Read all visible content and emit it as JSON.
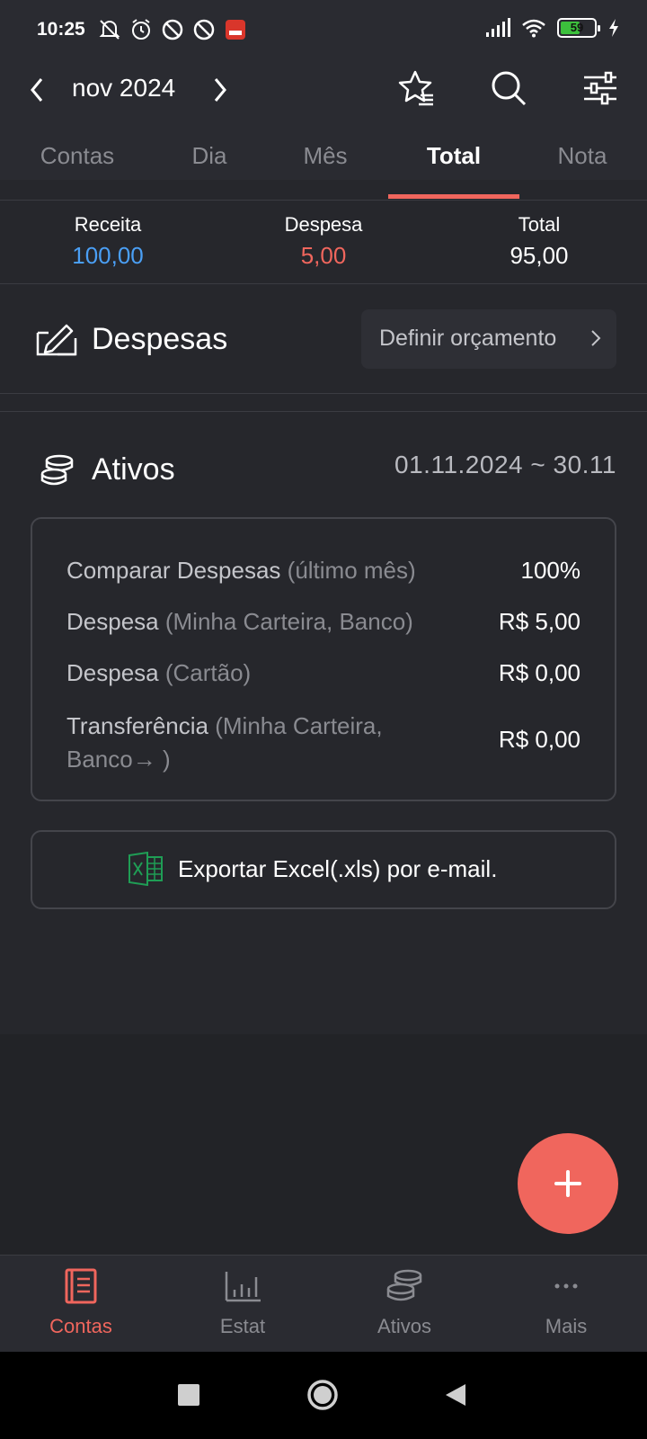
{
  "status_bar": {
    "time": "10:25",
    "battery": "59",
    "battery_level": 0.59,
    "icons_left": [
      "mute-bell-icon",
      "alarm-icon",
      "blocked-icon",
      "blocked-icon",
      "app-notification-icon"
    ],
    "icons_right": [
      "signal-icon",
      "wifi-icon",
      "battery-icon",
      "charging-icon"
    ]
  },
  "header": {
    "month": "nov 2024",
    "icons": [
      "chevron-left-icon",
      "chevron-right-icon",
      "star-list-icon",
      "search-icon",
      "filter-sliders-icon"
    ]
  },
  "tabs": [
    {
      "label": "Contas",
      "active": false
    },
    {
      "label": "Dia",
      "active": false
    },
    {
      "label": "Mês",
      "active": false
    },
    {
      "label": "Total",
      "active": true
    },
    {
      "label": "Nota",
      "active": false
    }
  ],
  "summary": {
    "income_label": "Receita",
    "income_value": "100,00",
    "expense_label": "Despesa",
    "expense_value": "5,00",
    "total_label": "Total",
    "total_value": "95,00"
  },
  "despesas": {
    "title": "Despesas",
    "budget_button": "Definir orçamento"
  },
  "ativos": {
    "title": "Ativos",
    "date_range": "01.11.2024  ~  30.11",
    "rows": [
      {
        "label": "Comparar Despesas",
        "sub": " (último mês)",
        "value": "100%"
      },
      {
        "label": "Despesa",
        "sub": " (Minha Carteira, Banco)",
        "value": "R$ 5,00"
      },
      {
        "label": "Despesa",
        "sub": " (Cartão)",
        "value": "R$ 0,00"
      },
      {
        "label": "Transferência",
        "sub": "  (Minha Carteira,",
        "sub2": "Banco→ )",
        "value": "R$ 0,00"
      }
    ],
    "export_label": "Exportar Excel(.xls) por e-mail."
  },
  "bottom_nav": [
    {
      "label": "Contas",
      "icon": "book-icon",
      "active": true
    },
    {
      "label": "Estat",
      "icon": "bar-chart-icon",
      "active": false
    },
    {
      "label": "Ativos",
      "icon": "coins-icon",
      "active": false
    },
    {
      "label": "Mais",
      "icon": "more-dots-icon",
      "active": false
    }
  ],
  "colors": {
    "accent": "#f0665d",
    "income": "#4a9ff5",
    "expense": "#f0665d",
    "background": "#26272c"
  }
}
